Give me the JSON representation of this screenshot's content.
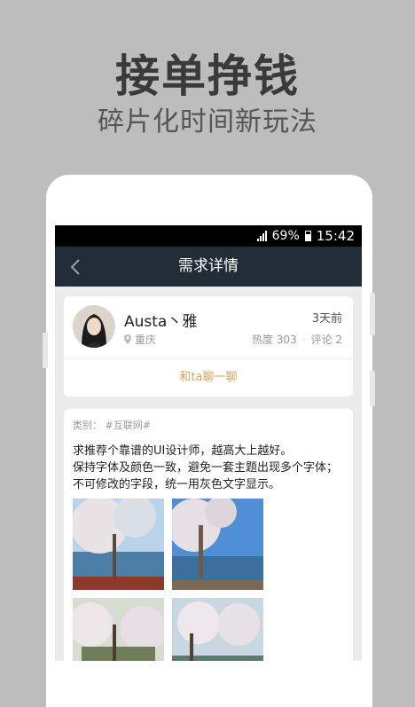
{
  "hero": {
    "title": "接单挣钱",
    "subtitle": "碎片化时间新玩法"
  },
  "status": {
    "battery": "69%",
    "time": "15:42"
  },
  "nav": {
    "title": "需求详情"
  },
  "user": {
    "name": "Austa丶雅",
    "location": "重庆",
    "time_ago": "3天前",
    "heat": "热度 303",
    "comments": "评论 2"
  },
  "chat_button": "和ta聊一聊",
  "post": {
    "category_label": "类别：",
    "category": "#互联网#",
    "lines": [
      "求推荐个靠谱的UI设计师，越高大上越好。",
      "保持字体及颜色一致，避免一套主题出现多个字体；",
      "不可修改的字段，统一用灰色文字显示。"
    ],
    "photos": [
      "cherry-blossom-lake-photo",
      "cherry-blossom-tree-photo",
      "garden-blossom-photo",
      "pond-blossom-photo"
    ]
  },
  "colors": {
    "nav_bg": "#222c36",
    "accent": "#d7a45a"
  }
}
